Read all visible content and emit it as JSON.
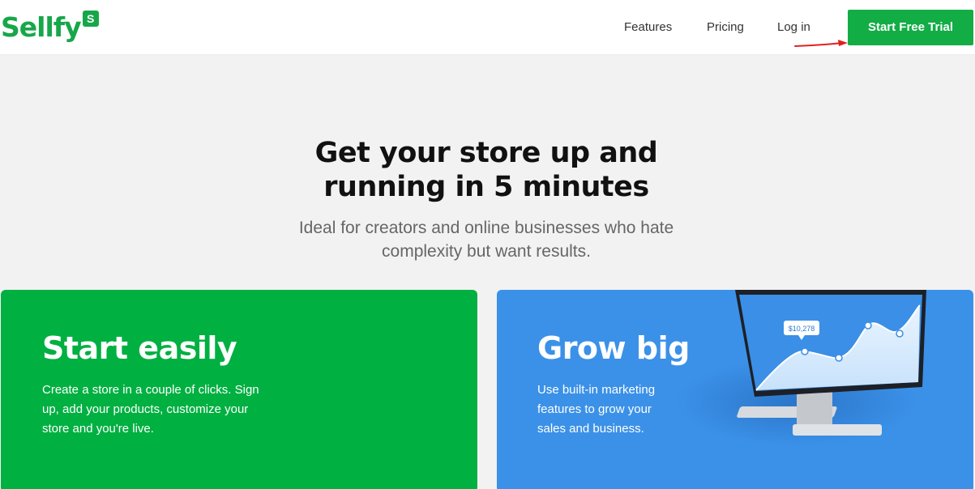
{
  "brand": {
    "name": "Sellfy",
    "badge": "S",
    "color": "#17a74a"
  },
  "nav": {
    "features": "Features",
    "pricing": "Pricing",
    "login": "Log in",
    "cta": "Start Free Trial"
  },
  "hero": {
    "title_line1": "Get your store up and",
    "title_line2": "running in 5 minutes",
    "subtitle_line1": "Ideal for creators and online businesses who hate",
    "subtitle_line2": "complexity but want results."
  },
  "cards": [
    {
      "title": "Start easily",
      "text_line1": "Create a store in a couple of clicks. Sign",
      "text_line2": "up, add your products, customize your",
      "text_line3": "store and you're live.",
      "color": "#00b041"
    },
    {
      "title": "Grow big",
      "text_line1": "Use built-in marketing",
      "text_line2": "features to grow your",
      "text_line3": "sales and business.",
      "color": "#3b91e8",
      "chart_label": "$10,278"
    }
  ],
  "annotation": {
    "arrow_color": "#e02020"
  }
}
